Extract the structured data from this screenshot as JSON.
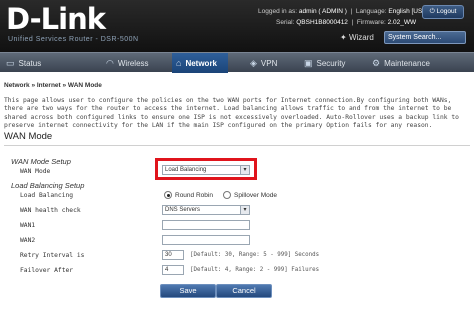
{
  "header": {
    "logo": "D-Link",
    "subtitle": "Unified Services Router - DSR-500N",
    "logged_in_label": "Logged in as:",
    "logged_in_value": "admin ( ADMIN )",
    "language_label": "Language:",
    "language_value": "English [US]",
    "serial_label": "Serial:",
    "serial_value": "QBSH1B8000412",
    "firmware_label": "Firmware:",
    "firmware_value": "2.02_WW",
    "logout": "Logout",
    "wizard": "Wizard",
    "search_placeholder": "System Search..."
  },
  "nav": {
    "tabs": [
      {
        "label": "Status",
        "icon": "monitor-icon"
      },
      {
        "label": "Wireless",
        "icon": "wifi-icon"
      },
      {
        "label": "Network",
        "icon": "network-icon"
      },
      {
        "label": "VPN",
        "icon": "vpn-icon"
      },
      {
        "label": "Security",
        "icon": "lock-icon"
      },
      {
        "label": "Maintenance",
        "icon": "wrench-icon"
      }
    ],
    "active": "Network"
  },
  "breadcrumb": "Network » Internet » WAN Mode",
  "description": "This page allows user to configure the policies on the two WAN ports for Internet connection.By configuring both WANs, there are two ways for the router to access the internet. Load balancing allows traffic to and from the internet to be shared across both configured links to ensure one ISP is not excessively overloaded. Auto-Rollover uses a backup link to preserve internet connectivity for the LAN if the main ISP configured on the primary Option fails for any reason.",
  "section_title": "WAN Mode",
  "wan_mode_setup": {
    "title": "WAN Mode Setup",
    "wan_mode_label": "WAN Mode",
    "wan_mode_value": "Load Balancing"
  },
  "load_balancing_setup": {
    "title": "Load Balancing Setup",
    "load_balancing_label": "Load Balancing",
    "option_round_robin": "Round Robin",
    "option_spillover": "Spillover Mode",
    "selected": "Round Robin",
    "wan_health_check_label": "WAN health check",
    "wan_health_check_value": "DNS Servers",
    "wan1_label": "WAN1",
    "wan1_value": "",
    "wan2_label": "WAN2",
    "wan2_value": "",
    "retry_interval_label": "Retry Interval is",
    "retry_interval_value": "30",
    "retry_interval_hint": "[Default: 30, Range: 5 - 999] Seconds",
    "failover_after_label": "Failover After",
    "failover_after_value": "4",
    "failover_after_hint": "[Default: 4, Range: 2 - 999] Failures"
  },
  "buttons": {
    "save": "Save",
    "cancel": "Cancel"
  },
  "colors": {
    "highlight": "#e0141c",
    "active_tab": "#1b4478"
  }
}
